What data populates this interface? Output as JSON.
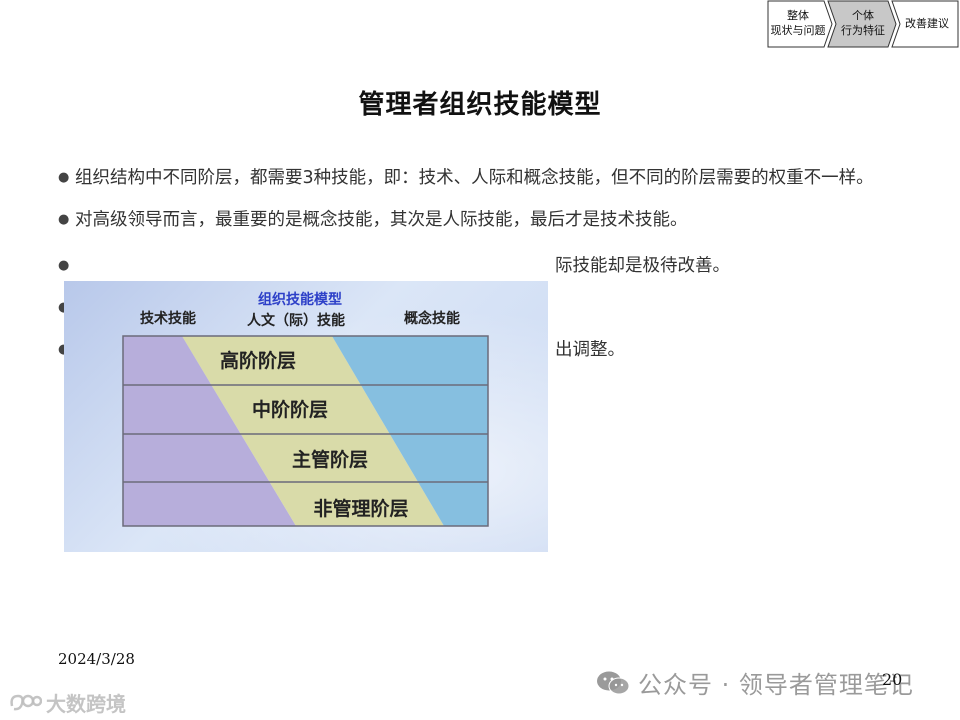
{
  "nav": {
    "steps": [
      {
        "line1": "整体",
        "line2": "现状与问题",
        "active": false
      },
      {
        "line1": "个体",
        "line2": "行为特征",
        "active": true
      },
      {
        "line1": "改善建议",
        "line2": "",
        "active": false
      }
    ]
  },
  "title": "管理者组织技能模型",
  "bullets": [
    "组织结构中不同阶层，都需要3种技能，即：技术、人际和概念技能，但不同的阶层需要的权重不一样。",
    "对高级领导而言，最重要的是概念技能，其次是人际技能，最后才是技术技能。",
    "际技能却是极待改善。",
    "",
    "出调整。"
  ],
  "figure": {
    "title": "组织技能模型",
    "col_left": "技术技能",
    "col_middle": "人文（际）技能",
    "col_right": "概念技能",
    "levels": [
      "高阶阶层",
      "中阶阶层",
      "主管阶层",
      "非管理阶层"
    ],
    "colors": {
      "technical": "#b7aedb",
      "human": "#d9dba9",
      "conceptual": "#86bfe0",
      "title": "#2d40c8"
    }
  },
  "footer": {
    "date": "2024/3/28",
    "page": "20",
    "watermark": "公众号 · 领导者管理笔记",
    "logo": "大数跨境"
  }
}
